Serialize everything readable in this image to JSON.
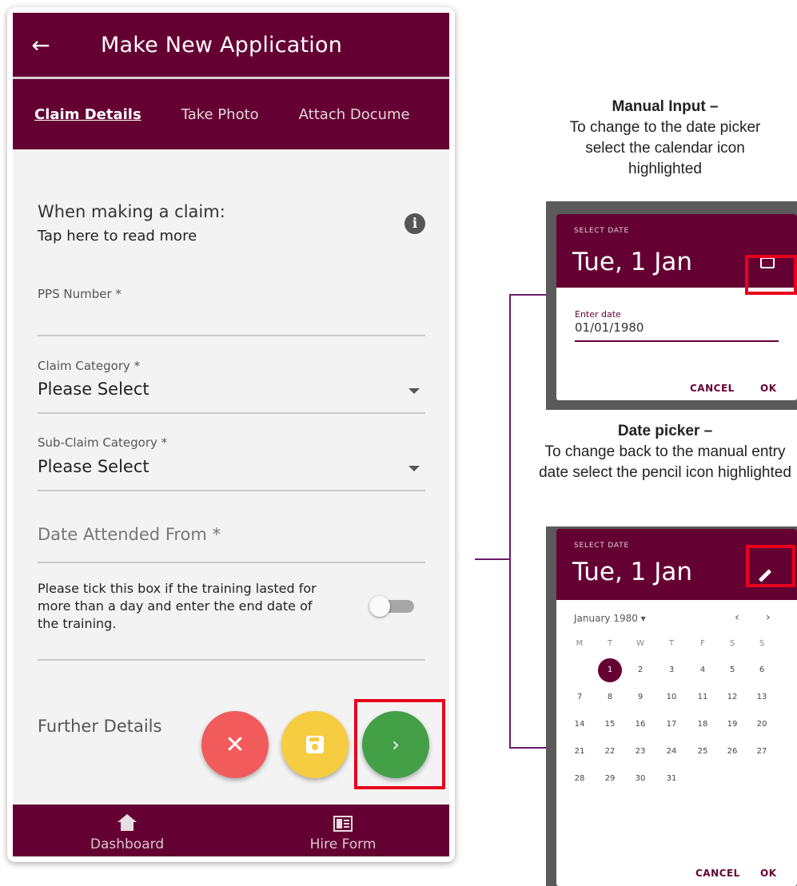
{
  "app": {
    "title": "Make New Application",
    "tabs": [
      "Claim Details",
      "Take Photo",
      "Attach Docume"
    ],
    "info_heading": "When making a claim:",
    "info_sub": "Tap here to read more",
    "fields": {
      "pps_label": "PPS Number *",
      "claim_category_label": "Claim Category *",
      "claim_category_value": "Please Select",
      "sub_claim_label": "Sub-Claim Category *",
      "sub_claim_value": "Please Select",
      "date_from_placeholder": "Date Attended From *",
      "tick_text": "Please tick this box if the training lasted for more than a day and enter the end date of the training.",
      "further_details": "Further Details"
    },
    "nav": {
      "dashboard": "Dashboard",
      "hire_form": "Hire Form"
    },
    "colors": {
      "brand": "#650033",
      "cancel": "#f25b5b",
      "save": "#f6cc40",
      "next": "#43a047",
      "highlight": "#e8001d"
    }
  },
  "annotations": {
    "manual_title": "Manual Input –",
    "manual_text": "To change to the date picker select the calendar icon highlighted",
    "picker_title": "Date picker –",
    "picker_text": "To change back to the manual entry date select the pencil icon highlighted"
  },
  "manual_dialog": {
    "select_date": "SELECT DATE",
    "heading": "Tue, 1 Jan",
    "enter_date_label": "Enter date",
    "enter_date_value": "01/01/1980",
    "cancel": "CANCEL",
    "ok": "OK"
  },
  "picker_dialog": {
    "select_date": "SELECT DATE",
    "heading": "Tue, 1 Jan",
    "month": "January 1980 ▾",
    "prev": "‹",
    "next": "›",
    "weekdays": [
      "M",
      "T",
      "W",
      "T",
      "F",
      "S",
      "S"
    ],
    "days": [
      "1",
      "2",
      "3",
      "4",
      "5",
      "6",
      "7",
      "8",
      "9",
      "10",
      "11",
      "12",
      "13",
      "14",
      "15",
      "16",
      "17",
      "18",
      "19",
      "20",
      "21",
      "22",
      "23",
      "24",
      "25",
      "26",
      "27",
      "28",
      "29",
      "30",
      "31"
    ],
    "selected_day": "1",
    "cancel": "CANCEL",
    "ok": "OK"
  }
}
